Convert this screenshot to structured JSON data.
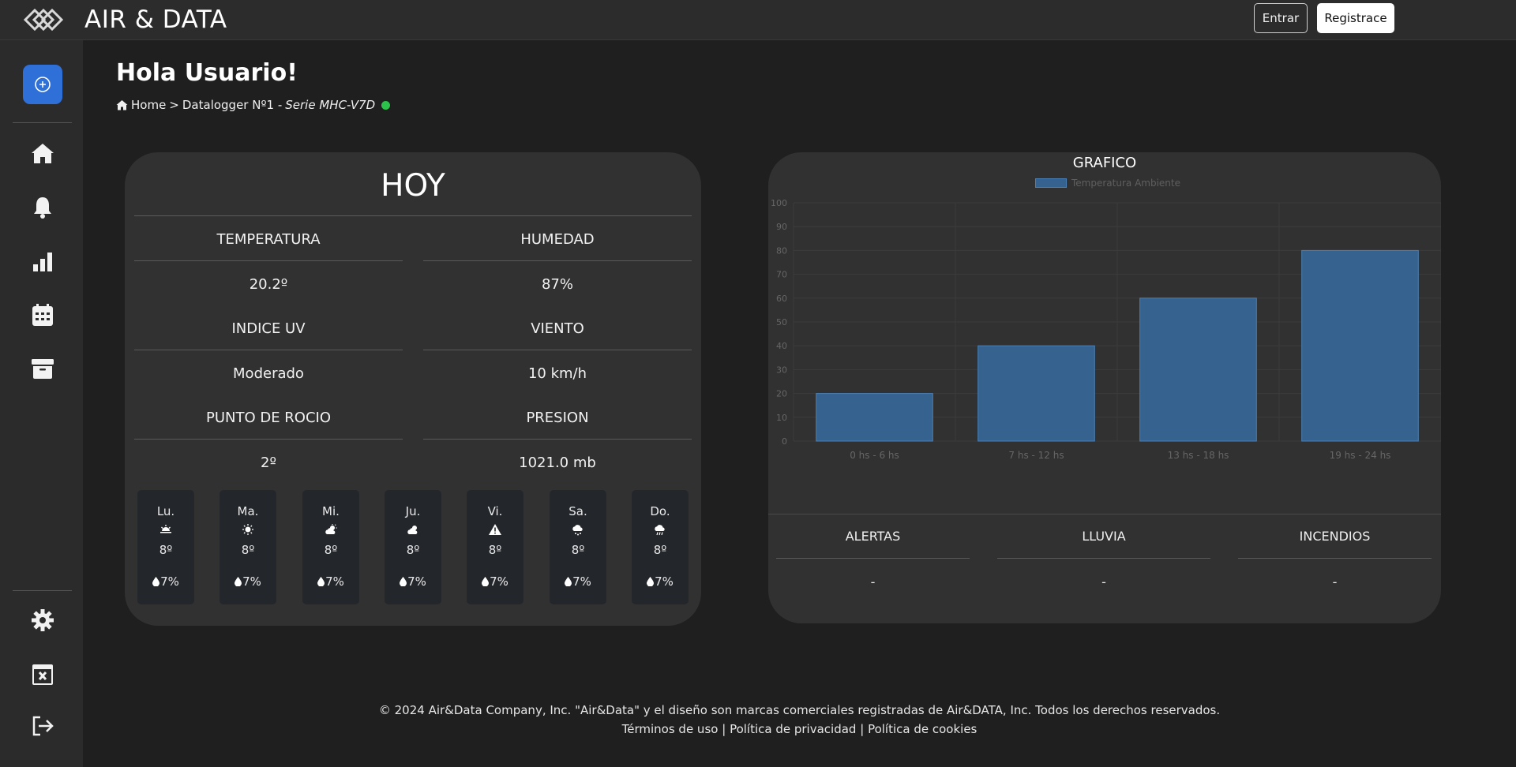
{
  "header": {
    "brand": "AIR & DATA",
    "login_label": "Entrar",
    "register_label": "Registrace"
  },
  "sidebar": {
    "items": [
      "add-icon",
      "home-icon",
      "bell-icon",
      "stats-icon",
      "calendar-icon",
      "archive-icon",
      "gear-icon",
      "calendar-x-icon",
      "logout-icon"
    ]
  },
  "main": {
    "greeting": "Hola Usuario!",
    "breadcrumb": {
      "home": "Home",
      "sep": ">",
      "device": "Datalogger Nº1 -",
      "serie": "Serie MHC-V7D",
      "status_color": "#2cc14a"
    }
  },
  "today": {
    "title": "HOY",
    "metrics": [
      {
        "label": "TEMPERATURA",
        "value": "20.2º"
      },
      {
        "label": "HUMEDAD",
        "value": "87%"
      },
      {
        "label": "INDICE UV",
        "value": "Moderado"
      },
      {
        "label": "VIENTO",
        "value": "10 km/h"
      },
      {
        "label": "PUNTO DE ROCIO",
        "value": "2º"
      },
      {
        "label": "PRESION",
        "value": "1021.0 mb"
      }
    ],
    "forecast": [
      {
        "day": "Lu.",
        "icon": "sunrise-icon",
        "temp": "8º",
        "rain": "7%"
      },
      {
        "day": "Ma.",
        "icon": "sun-icon",
        "temp": "8º",
        "rain": "7%"
      },
      {
        "day": "Mi.",
        "icon": "cloud-sun-icon",
        "temp": "8º",
        "rain": "7%"
      },
      {
        "day": "Ju.",
        "icon": "cloud-sun-icon",
        "temp": "8º",
        "rain": "7%"
      },
      {
        "day": "Vi.",
        "icon": "warning-icon",
        "temp": "8º",
        "rain": "7%"
      },
      {
        "day": "Sa.",
        "icon": "cloud-snow-icon",
        "temp": "8º",
        "rain": "7%"
      },
      {
        "day": "Do.",
        "icon": "cloud-rain-icon",
        "temp": "8º",
        "rain": "7%"
      }
    ]
  },
  "chart_panel": {
    "title": "GRAFICO",
    "stats": [
      {
        "label": "ALERTAS",
        "value": "-"
      },
      {
        "label": "LLUVIA",
        "value": "-"
      },
      {
        "label": "INCENDIOS",
        "value": "-"
      }
    ]
  },
  "chart_data": {
    "type": "bar",
    "categories": [
      "0 hs - 6 hs",
      "7 hs - 12 hs",
      "13 hs - 18 hs",
      "19 hs - 24 hs"
    ],
    "series": [
      {
        "name": "Temperatura Ambiente",
        "values": [
          20,
          40,
          60,
          80
        ]
      }
    ],
    "ylim": [
      0,
      100
    ],
    "yticks": [
      0,
      10,
      20,
      30,
      40,
      50,
      60,
      70,
      80,
      90,
      100
    ],
    "grid": true,
    "legend": "top-center",
    "bar_color": "#36628f"
  },
  "footer": {
    "line1": "© 2024 Air&Data Company, Inc. \"Air&Data\" y el diseño son marcas comerciales registradas de Air&DATA, Inc. Todos los derechos reservados.",
    "terms": "Términos de uso",
    "privacy": "Política de privacidad",
    "cookies": "Política de cookies",
    "sep": "|"
  }
}
